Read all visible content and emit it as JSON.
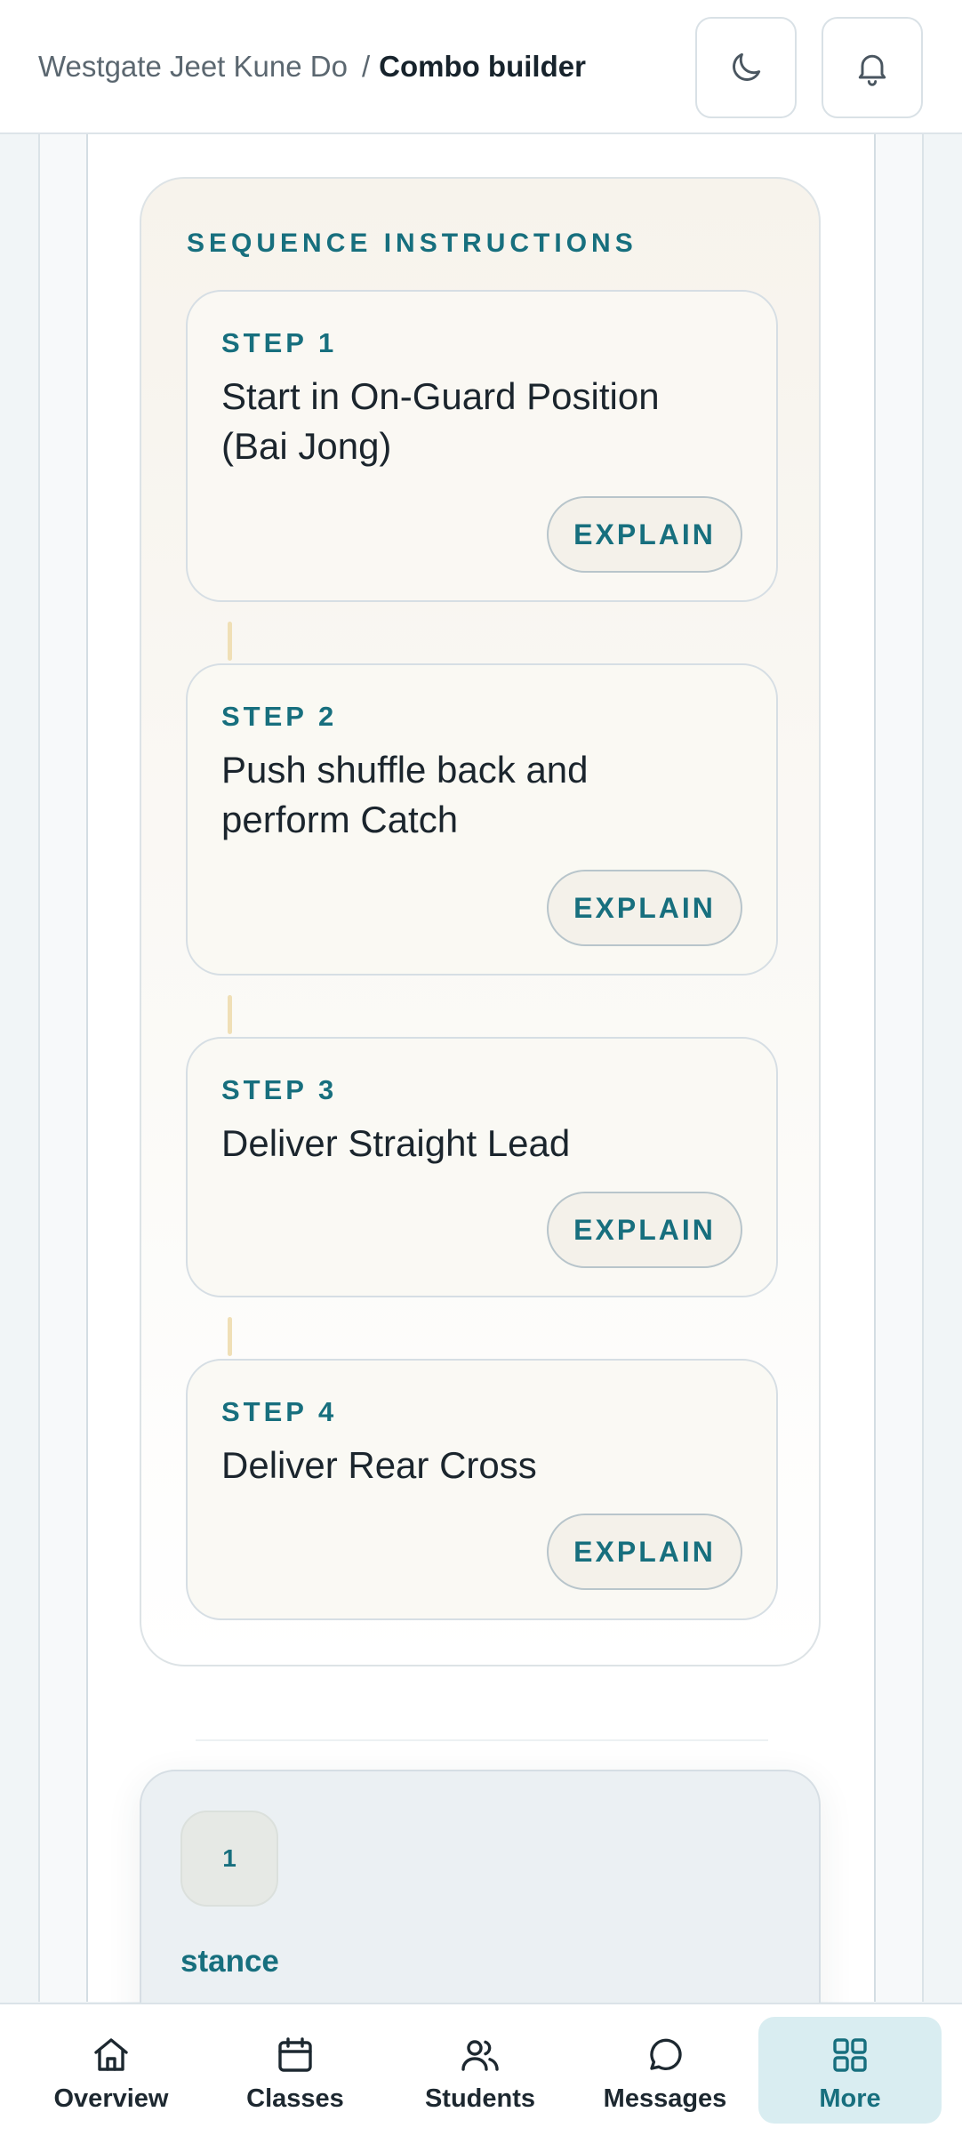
{
  "header": {
    "breadcrumb_root": "Westgate Jeet Kune Do",
    "breadcrumb_separator": "/",
    "breadcrumb_current": "Combo builder",
    "theme_icon": "moon-icon",
    "notification_icon": "bell-icon"
  },
  "instructions": {
    "heading": "SEQUENCE INSTRUCTIONS",
    "steps": [
      {
        "label": "STEP 1",
        "text": "Start in On-Guard Position (Bai Jong)",
        "button": "EXPLAIN"
      },
      {
        "label": "STEP 2",
        "text": "Push shuffle back and perform Catch",
        "button": "EXPLAIN"
      },
      {
        "label": "STEP 3",
        "text": "Deliver Straight Lead",
        "button": "EXPLAIN"
      },
      {
        "label": "STEP 4",
        "text": "Deliver Rear Cross",
        "button": "EXPLAIN"
      }
    ]
  },
  "combo": {
    "number": "1",
    "name": "stance"
  },
  "nav": {
    "items": [
      {
        "label": "Overview",
        "icon": "home-icon"
      },
      {
        "label": "Classes",
        "icon": "calendar-icon"
      },
      {
        "label": "Students",
        "icon": "users-icon"
      },
      {
        "label": "Messages",
        "icon": "chat-icon"
      },
      {
        "label": "More",
        "icon": "grid-icon"
      }
    ],
    "active": "More"
  },
  "colors": {
    "accent": "#176f7e",
    "active_nav_bg": "#d9edf1",
    "connector": "#f0dfb6"
  }
}
